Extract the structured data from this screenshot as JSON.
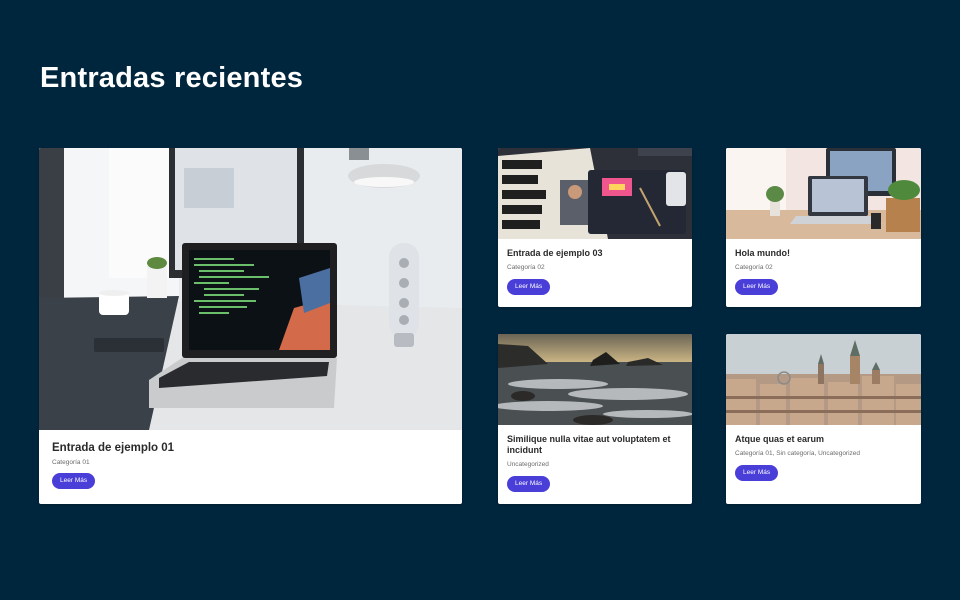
{
  "section": {
    "title": "Entradas recientes"
  },
  "posts": [
    {
      "title": "Entrada de ejemplo 01",
      "categories": "Categoría 01",
      "button_label": "Leer Más",
      "image": "laptop-desk-photo"
    },
    {
      "title": "Entrada de ejemplo 03",
      "categories": "Categoría 02",
      "button_label": "Leer Más",
      "image": "magazine-desk-photo"
    },
    {
      "title": "Hola mundo!",
      "categories": "Categoría 02",
      "button_label": "Leer Más",
      "image": "workspace-laptop-photo"
    },
    {
      "title": "Similique nulla vitae aut voluptatem et incidunt",
      "categories": "Uncategorized",
      "button_label": "Leer Más",
      "image": "seascape-rocks-photo"
    },
    {
      "title": "Atque quas et earum",
      "categories": "Categoría 01, Sin categoría, Uncategorized",
      "button_label": "Leer Más",
      "image": "city-skyline-photo"
    }
  ],
  "colors": {
    "background": "#00263e",
    "button": "#4a3ed8",
    "card": "#ffffff"
  }
}
